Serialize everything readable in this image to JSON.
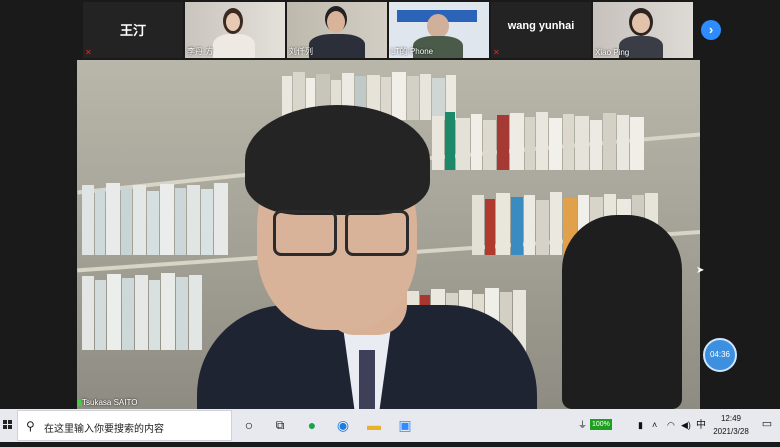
{
  "participants": [
    {
      "name": "王汀",
      "display": "name-only",
      "muted": true
    },
    {
      "name": "李丹 方",
      "display": "video",
      "muted": false
    },
    {
      "name": "刘仟列",
      "display": "video",
      "muted": false
    },
    {
      "name": "LT的 Phone",
      "display": "video",
      "muted": false
    },
    {
      "name": "wang yunhai",
      "display": "name-only",
      "muted": true
    },
    {
      "name": "Xiao Ping",
      "display": "video",
      "muted": false
    }
  ],
  "next_page_icon": "chevron-right-icon",
  "main_speaker": {
    "name": "Tsukasa SAITO"
  },
  "meeting_timer": "04:36",
  "taskbar": {
    "search_placeholder": "在这里输入你要搜索的内容",
    "battery_label": "100%",
    "ime_label": "中",
    "time": "12:49",
    "date": "2021/3/28"
  },
  "colors": {
    "accent": "#2d8cff",
    "mute": "#e02828",
    "taskbar": "#e7e9ee"
  }
}
